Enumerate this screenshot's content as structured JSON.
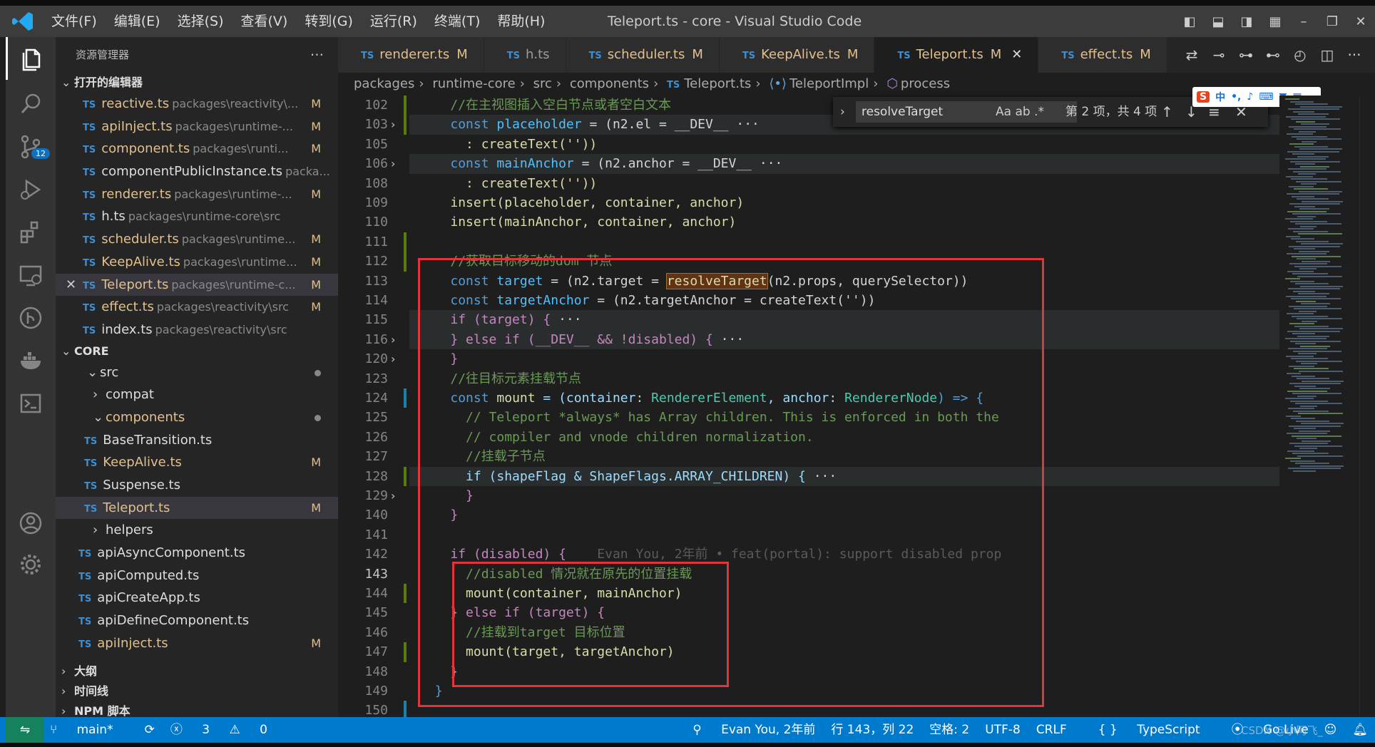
{
  "titlebar": {
    "menu": [
      "文件(F)",
      "编辑(E)",
      "选择(S)",
      "查看(V)",
      "转到(G)",
      "运行(R)",
      "终端(T)",
      "帮助(H)"
    ],
    "title": "Teleport.ts - core - Visual Studio Code",
    "controls": [
      "toggle-sidebar-icon",
      "toggle-panel-icon",
      "toggle-secondary-icon",
      "layout-icon",
      "minimize-icon",
      "restore-icon",
      "close-icon"
    ]
  },
  "activity": {
    "items": [
      "explorer",
      "search",
      "source-control",
      "run-debug",
      "extensions",
      "remote-explorer",
      "gitlens",
      "docker",
      "terminal",
      "accounts",
      "settings"
    ],
    "scm_badge": "12"
  },
  "sidebar": {
    "title": "资源管理器",
    "open_editors_label": "打开的编辑器",
    "open_editors": [
      {
        "name": "reactive.ts",
        "path": "packages\\reactivity\\...",
        "badge": "M"
      },
      {
        "name": "apiInject.ts",
        "path": "packages\\runtime-...",
        "badge": "M"
      },
      {
        "name": "component.ts",
        "path": "packages\\runti...",
        "badge": "M"
      },
      {
        "name": "componentPublicInstance.ts",
        "path": "packa...",
        "badge": ""
      },
      {
        "name": "renderer.ts",
        "path": "packages\\runtime-...",
        "badge": "M"
      },
      {
        "name": "h.ts",
        "path": "packages\\runtime-core\\src",
        "badge": ""
      },
      {
        "name": "scheduler.ts",
        "path": "packages\\runtime...",
        "badge": "M"
      },
      {
        "name": "KeepAlive.ts",
        "path": "packages\\runtime...",
        "badge": "M"
      },
      {
        "name": "Teleport.ts",
        "path": "packages\\runtime-c...",
        "badge": "M"
      },
      {
        "name": "effect.ts",
        "path": "packages\\reactivity\\src",
        "badge": "M"
      },
      {
        "name": "index.ts",
        "path": "packages\\reactivity\\src",
        "badge": ""
      }
    ],
    "workspace_label": "CORE",
    "tree": {
      "src": "src",
      "compat": "compat",
      "components": "components",
      "component_files": [
        {
          "name": "BaseTransition.ts",
          "badge": ""
        },
        {
          "name": "KeepAlive.ts",
          "badge": "M"
        },
        {
          "name": "Suspense.ts",
          "badge": ""
        },
        {
          "name": "Teleport.ts",
          "badge": "M"
        }
      ],
      "helpers": "helpers",
      "src_files": [
        {
          "name": "apiAsyncComponent.ts",
          "badge": ""
        },
        {
          "name": "apiComputed.ts",
          "badge": ""
        },
        {
          "name": "apiCreateApp.ts",
          "badge": ""
        },
        {
          "name": "apiDefineComponent.ts",
          "badge": ""
        },
        {
          "name": "apiInject.ts",
          "badge": "M"
        }
      ]
    },
    "outline_label": "大纲",
    "timeline_label": "时间线",
    "npm_label": "NPM 脚本"
  },
  "tabs": [
    {
      "name": "renderer.ts",
      "badge": "M"
    },
    {
      "name": "h.ts",
      "badge": ""
    },
    {
      "name": "scheduler.ts",
      "badge": "M"
    },
    {
      "name": "KeepAlive.ts",
      "badge": "M"
    },
    {
      "name": "Teleport.ts",
      "badge": "M"
    },
    {
      "name": "effect.ts",
      "badge": "M"
    }
  ],
  "breadcrumb": [
    "packages",
    "runtime-core",
    "src",
    "components",
    "Teleport.ts",
    "TeleportImpl",
    "process"
  ],
  "find": {
    "query": "resolveTarget",
    "options": "Aa  ab  .*",
    "count": "第 2 项，共 4 项"
  },
  "ime": {
    "label": "中"
  },
  "editor": {
    "lines": [
      {
        "n": "102",
        "fold": "",
        "bar": "#587c0c"
      },
      {
        "n": "103",
        "fold": "›",
        "bar": "#587c0c"
      },
      {
        "n": "105",
        "fold": "",
        "bar": ""
      },
      {
        "n": "106",
        "fold": "›",
        "bar": ""
      },
      {
        "n": "108",
        "fold": "",
        "bar": ""
      },
      {
        "n": "109",
        "fold": "",
        "bar": ""
      },
      {
        "n": "110",
        "fold": "",
        "bar": ""
      },
      {
        "n": "111",
        "fold": "",
        "bar": "#587c0c"
      },
      {
        "n": "112",
        "fold": "",
        "bar": "#587c0c"
      },
      {
        "n": "113",
        "fold": "",
        "bar": ""
      },
      {
        "n": "114",
        "fold": "",
        "bar": ""
      },
      {
        "n": "115",
        "fold": "",
        "bar": ""
      },
      {
        "n": "116",
        "fold": "›",
        "bar": ""
      },
      {
        "n": "120",
        "fold": "›",
        "bar": ""
      },
      {
        "n": "123",
        "fold": "",
        "bar": ""
      },
      {
        "n": "124",
        "fold": "",
        "bar": "#1b81a8"
      },
      {
        "n": "125",
        "fold": "",
        "bar": ""
      },
      {
        "n": "126",
        "fold": "",
        "bar": ""
      },
      {
        "n": "127",
        "fold": "",
        "bar": ""
      },
      {
        "n": "128",
        "fold": "",
        "bar": "#587c0c"
      },
      {
        "n": "129",
        "fold": "›",
        "bar": ""
      },
      {
        "n": "140",
        "fold": "",
        "bar": ""
      },
      {
        "n": "141",
        "fold": "",
        "bar": ""
      },
      {
        "n": "142",
        "fold": "",
        "bar": ""
      },
      {
        "n": "143",
        "fold": "",
        "bar": ""
      },
      {
        "n": "144",
        "fold": "",
        "bar": "#587c0c"
      },
      {
        "n": "145",
        "fold": "",
        "bar": ""
      },
      {
        "n": "146",
        "fold": "",
        "bar": ""
      },
      {
        "n": "147",
        "fold": "",
        "bar": "#587c0c"
      },
      {
        "n": "148",
        "fold": "",
        "bar": ""
      },
      {
        "n": "149",
        "fold": "",
        "bar": ""
      },
      {
        "n": "150",
        "fold": "",
        "bar": "#1b81a8"
      }
    ],
    "code": {
      "l102": "//在主视图插入空白节点或者空白文本",
      "l103a": "const",
      "l103b": "placeholder",
      "l103c": " = (n2.el = __DEV__",
      "l105": "  : createText(''))",
      "l106a": "const",
      "l106b": "mainAnchor",
      "l106c": " = (n2.anchor = __DEV__",
      "l108": "  : createText(''))",
      "l109": "insert(placeholder, container, anchor)",
      "l110": "insert(mainAnchor, container, anchor)",
      "l113": "//获取目标移动的dom 节点",
      "l114a": "const",
      "l114b": "target",
      "l114c": " = (n2.target = ",
      "l114d": "resolveTarget",
      "l114e": "(n2.props, querySelector))",
      "l115a": "const",
      "l115b": "targetAnchor",
      "l115c": " = (n2.targetAnchor = createText(''))",
      "l116": "if (target) {",
      "l120": "} else if (__DEV__ && !disabled) {",
      "l123": "}",
      "l124": "//往目标元素挂载节点",
      "l125a": "const",
      "l125b": "mount",
      "l125c": " = (container: ",
      "l125d": "RendererElement",
      "l125e": ", anchor: ",
      "l125f": "RendererNode",
      "l125g": ") => {",
      "l126": "  // Teleport *always* has Array children. This is enforced in both the",
      "l127": "  // compiler and vnode children normalization.",
      "l128": "  //挂载子节点",
      "l129": "  if (shapeFlag & ShapeFlags.ARRAY_CHILDREN) {",
      "l140": "  }",
      "l141": "}",
      "l143": "if (disabled) {",
      "l143blame": "Evan You, 2年前 • feat(portal): support disabled prop",
      "l144": "  //disabled 情况就在原先的位置挂载",
      "l145": "  mount(container, mainAnchor)",
      "l146": "} else if (target) {",
      "l147": "  //挂载到target 目标位置",
      "l148": "  mount(target, targetAnchor)",
      "l149": "}",
      "l150": "}"
    }
  },
  "statusbar": {
    "branch": "main*",
    "errors": "3",
    "warnings": "0",
    "blame": "Evan You, 2年前",
    "position": "行 143，列 22",
    "spaces": "空格: 2",
    "encoding": "UTF-8",
    "eol": "CRLF",
    "language": "TypeScript",
    "golive": "Go Live"
  },
  "watermark": "CSDN @小阿飞_"
}
